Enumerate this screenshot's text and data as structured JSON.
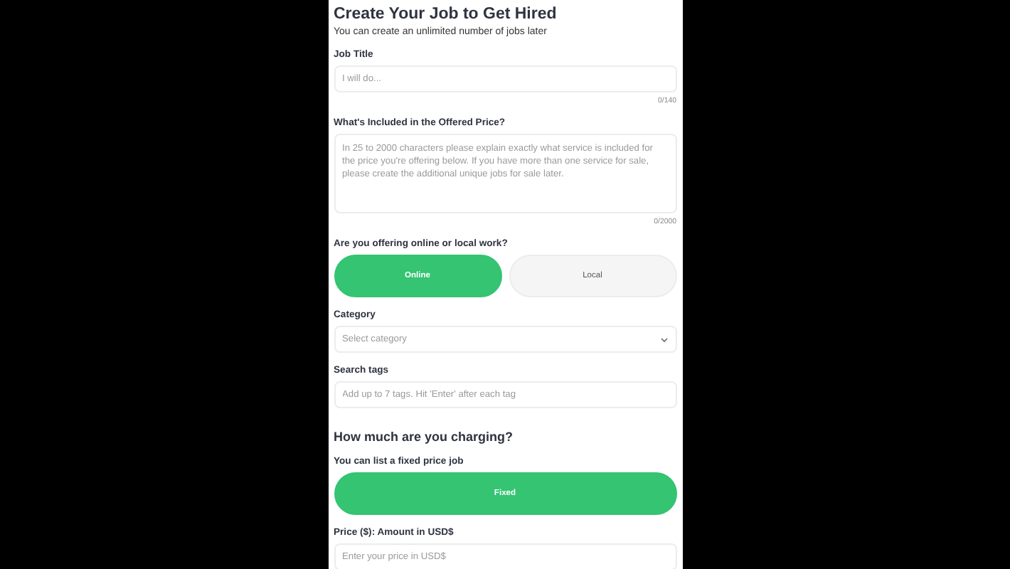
{
  "title": "Create Your Job to Get Hired",
  "subtitle": "You can create an unlimited number of jobs later",
  "fields": [
    {
      "kind": "text",
      "label": "Job Title",
      "placeholder": "I will do...",
      "counter": "0/140"
    },
    {
      "kind": "textarea",
      "label": "What's Included in the Offered Price?",
      "placeholder": "In 25 to 2000 characters please explain exactly what service is included for the price you're offering below. If you have more than one service for sale, please create the additional unique jobs for sale later.",
      "counter": "0/2000"
    },
    {
      "kind": "toggle",
      "label": "Are you offering online or local work?",
      "options": [
        {
          "label": "Online",
          "selected": true
        },
        {
          "label": "Local",
          "selected": false
        }
      ]
    },
    {
      "kind": "select",
      "label": "Category",
      "placeholder": "Select category"
    },
    {
      "kind": "text",
      "label": "Search tags",
      "placeholder": "Add up to 7 tags. Hit 'Enter' after each tag"
    },
    {
      "kind": "heading",
      "label": "How much are you charging?"
    },
    {
      "kind": "toggle",
      "label": "You can list a fixed price job",
      "options": [
        {
          "label": "Fixed",
          "selected": true
        }
      ]
    },
    {
      "kind": "text",
      "label": "Price ($): Amount in USD$",
      "placeholder": "Enter your price in USD$"
    }
  ]
}
